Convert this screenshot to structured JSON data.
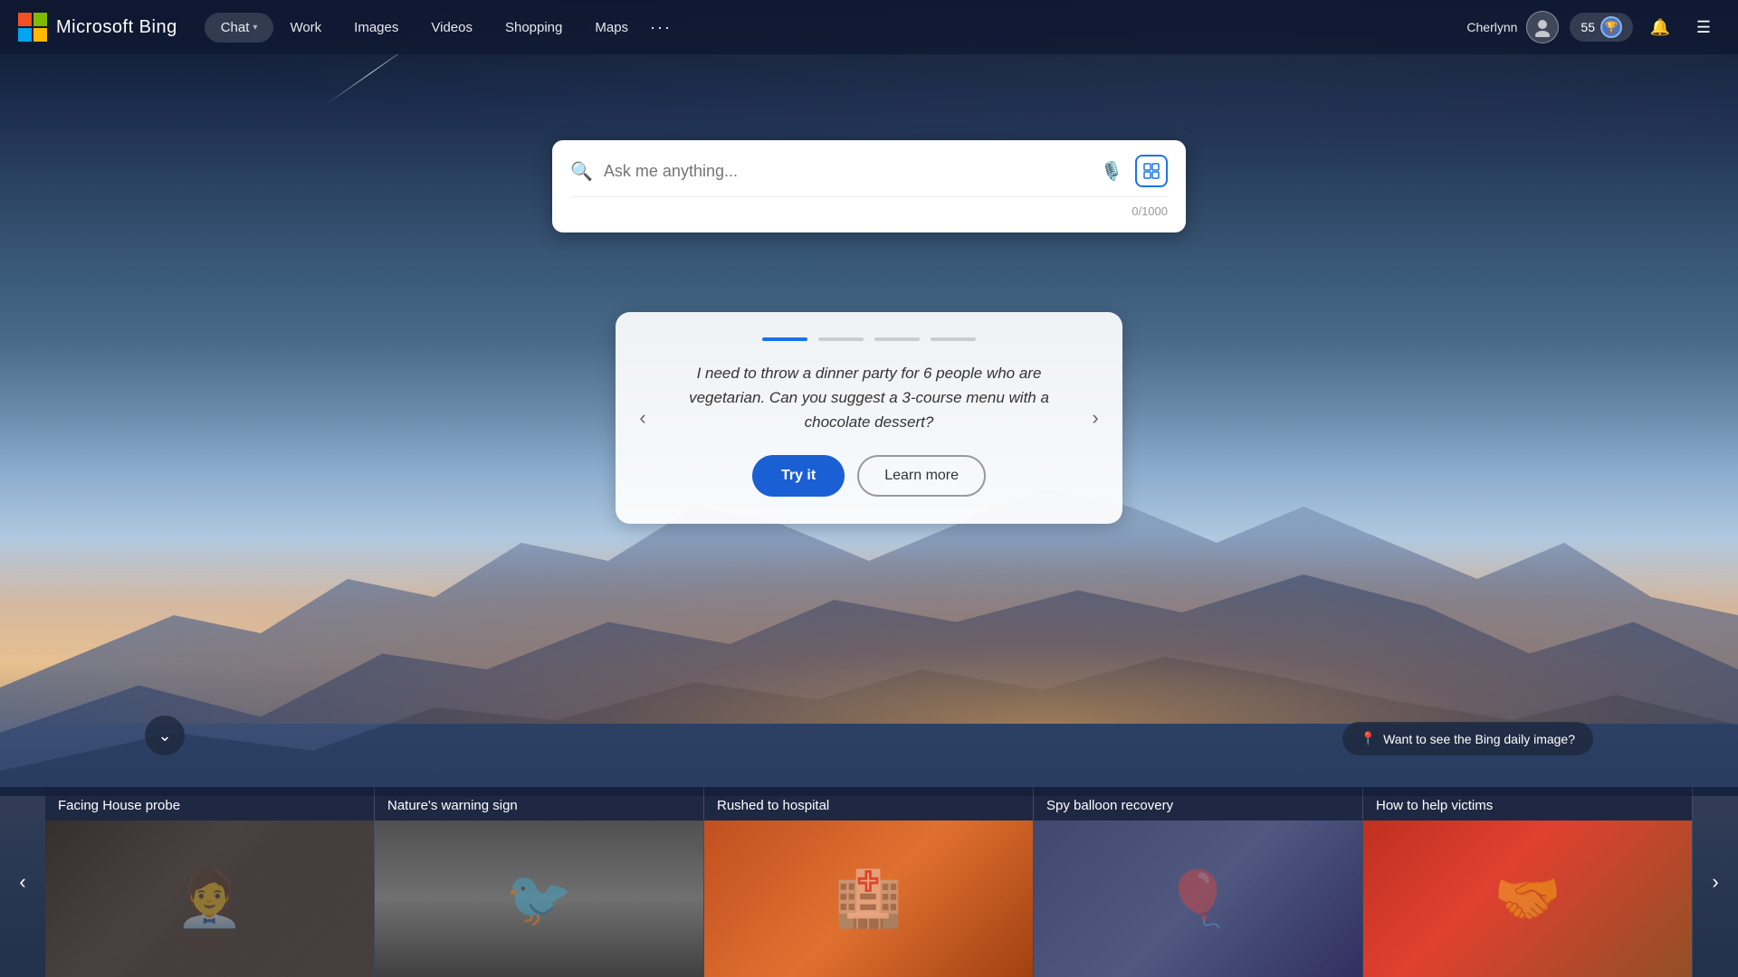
{
  "brand": {
    "name": "Microsoft Bing",
    "logo_colors": [
      "#f25022",
      "#7fba00",
      "#00a4ef",
      "#ffb900"
    ]
  },
  "navbar": {
    "links": [
      {
        "id": "chat",
        "label": "Chat",
        "has_chevron": true
      },
      {
        "id": "work",
        "label": "Work",
        "has_chevron": false
      },
      {
        "id": "images",
        "label": "Images",
        "has_chevron": false
      },
      {
        "id": "videos",
        "label": "Videos",
        "has_chevron": false
      },
      {
        "id": "shopping",
        "label": "Shopping",
        "has_chevron": false
      },
      {
        "id": "maps",
        "label": "Maps",
        "has_chevron": false
      }
    ],
    "more_label": "···",
    "user": {
      "name": "Cherlynn",
      "rewards_score": "55"
    }
  },
  "search": {
    "placeholder": "Ask me anything...",
    "char_count": "0/1000"
  },
  "suggestion_card": {
    "text": "I need to throw a dinner party for 6 people who are vegetarian. Can you suggest a 3-course menu with a chocolate dessert?",
    "try_label": "Try it",
    "learn_more_label": "Learn more",
    "dots_count": 4,
    "active_dot": 0
  },
  "scroll_down": {
    "label": "↓"
  },
  "daily_image": {
    "label": "Want to see the Bing daily image?"
  },
  "news": {
    "cards": [
      {
        "id": "card1",
        "title": "Facing House probe",
        "img_class": "news-img-1"
      },
      {
        "id": "card2",
        "title": "Nature's warning sign",
        "img_class": "news-img-2"
      },
      {
        "id": "card3",
        "title": "Rushed to hospital",
        "img_class": "news-img-3"
      },
      {
        "id": "card4",
        "title": "Spy balloon recovery",
        "img_class": "news-img-4"
      },
      {
        "id": "card5",
        "title": "How to help victims",
        "img_class": "news-img-5"
      }
    ]
  }
}
